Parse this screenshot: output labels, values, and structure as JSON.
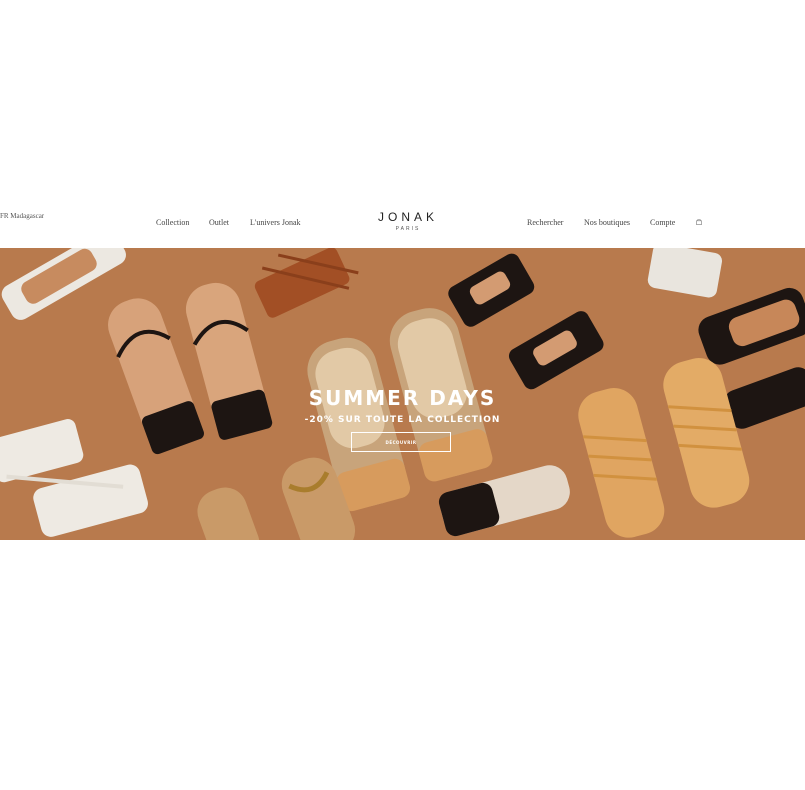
{
  "header": {
    "locale": "FR  Madagascar",
    "nav_left": [
      "Collection",
      "Outlet",
      "L'univers Jonak"
    ],
    "brand": {
      "name": "JONAK",
      "sub": "PARIS"
    },
    "nav_right": [
      "Rechercher",
      "Nos boutiques",
      "Compte"
    ],
    "cart_icon": "shopping-bag-icon"
  },
  "hero": {
    "title": "SUMMER DAYS",
    "subtitle": "-20% SUR TOUTE LA COLLECTION",
    "cta": "DÉCOUVRIR",
    "background_color": "#b87a4d"
  }
}
